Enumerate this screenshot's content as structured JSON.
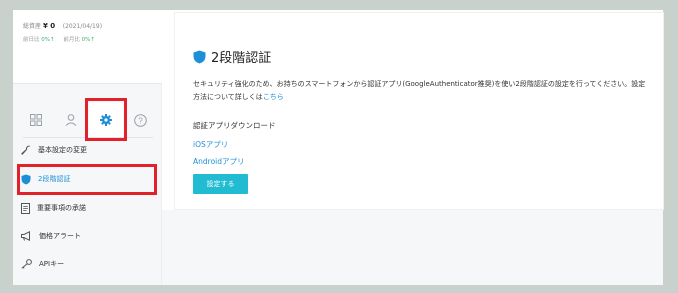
{
  "account": {
    "balance_label": "総資産",
    "balance_value": "¥ 0",
    "date": "(2021/04/19)",
    "day_label": "前日比",
    "day_value": "0%↑",
    "month_label": "前月比",
    "month_value": "0%↑"
  },
  "tabs": [
    {
      "icon": "grid-icon"
    },
    {
      "icon": "user-icon"
    },
    {
      "icon": "gear-icon"
    },
    {
      "icon": "help-icon"
    }
  ],
  "menu": [
    {
      "label": "基本設定の変更",
      "icon": "wrench-icon"
    },
    {
      "label": "2段階認証",
      "icon": "shield-icon"
    },
    {
      "label": "重要事項の承諾",
      "icon": "document-icon"
    },
    {
      "label": "価格アラート",
      "icon": "megaphone-icon"
    },
    {
      "label": "APIキー",
      "icon": "key-icon"
    }
  ],
  "main": {
    "title": "2段階認証",
    "description": "セキュリティ強化のため、お持ちのスマートフォンから認証アプリ(GoogleAuthenticator推奨)を使い2段階認証の設定を行ってください。設定方法について詳しくは",
    "description_link": "こちら",
    "download_heading": "認証アプリダウンロード",
    "ios_link": "iOSアプリ",
    "android_link": "Androidアプリ",
    "setup_button": "設定する"
  },
  "colors": {
    "accent": "#21bcd1",
    "link": "#1e8fd6",
    "highlight": "#e2212b",
    "background": "#c9d1cd"
  }
}
